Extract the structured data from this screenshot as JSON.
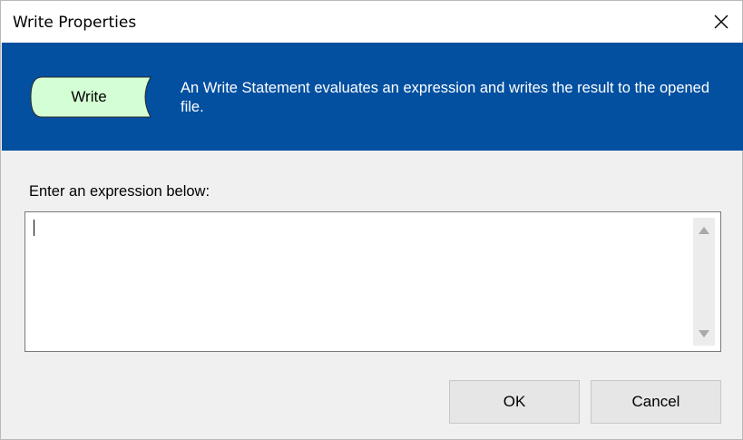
{
  "window": {
    "title": "Write Properties",
    "close_icon": "close-icon"
  },
  "banner": {
    "background_color": "#0350a0",
    "shape": {
      "label": "Write",
      "fill_color": "#d4ffd4",
      "icon": "write-statement-shape"
    },
    "description": "An Write Statement evaluates an expression and writes the result to the opened file."
  },
  "form": {
    "prompt": "Enter an expression below:",
    "expression_value": "",
    "scrollbar_icons": [
      "scroll-up-arrow-icon",
      "scroll-down-arrow-icon"
    ]
  },
  "buttons": {
    "ok_label": "OK",
    "cancel_label": "Cancel"
  }
}
